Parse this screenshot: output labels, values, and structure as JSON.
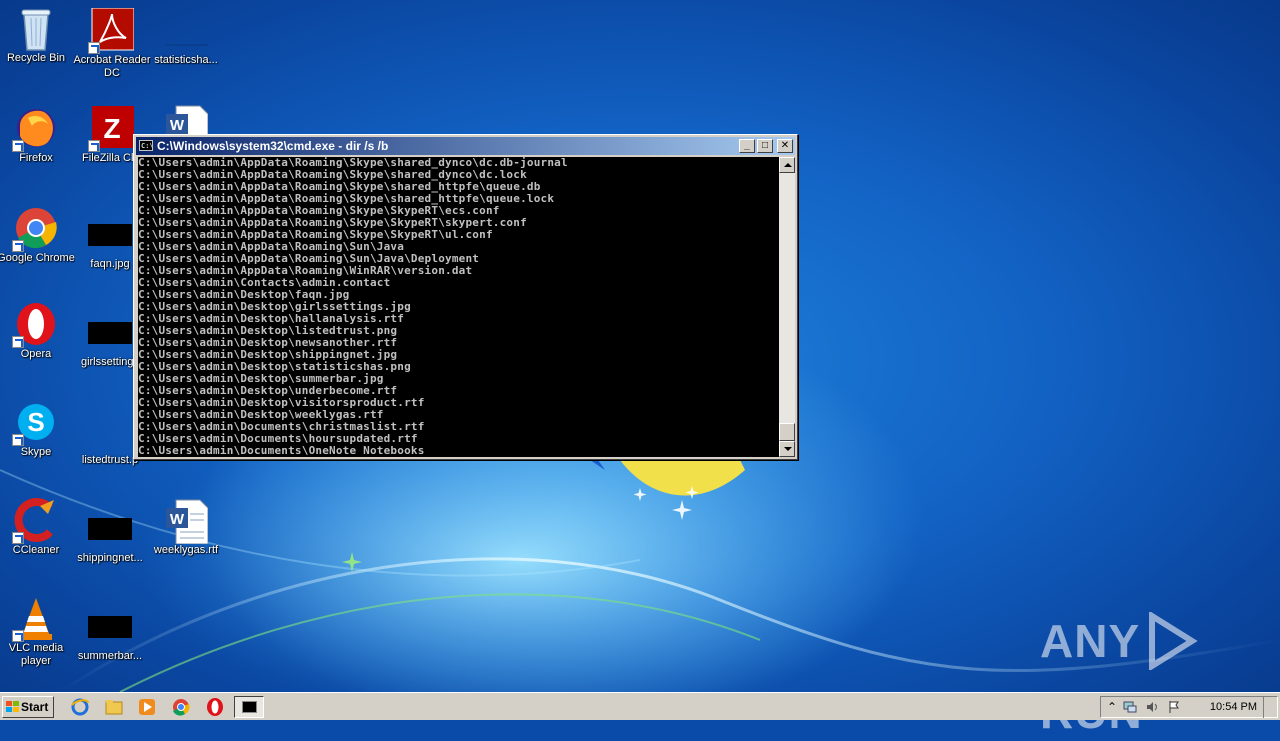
{
  "desktop": {
    "icons": [
      {
        "label": "Recycle Bin",
        "icon": "recycle-bin-icon"
      },
      {
        "label": "Acrobat Reader DC",
        "icon": "acrobat-icon"
      },
      {
        "label": "statisticsha...",
        "icon": "image-file-icon"
      },
      {
        "label": "Firefox",
        "icon": "firefox-icon"
      },
      {
        "label": "FileZilla Clie",
        "icon": "filezilla-icon"
      },
      {
        "label": "Google Chrome",
        "icon": "chrome-icon"
      },
      {
        "label": "faqn.jpg",
        "icon": "image-file-icon"
      },
      {
        "label": "Opera",
        "icon": "opera-icon"
      },
      {
        "label": "girlssettings",
        "icon": "image-file-icon"
      },
      {
        "label": "Skype",
        "icon": "skype-icon"
      },
      {
        "label": "listedtrust.p",
        "icon": "image-file-icon"
      },
      {
        "label": "CCleaner",
        "icon": "ccleaner-icon"
      },
      {
        "label": "shippingnet...",
        "icon": "image-file-icon"
      },
      {
        "label": "weeklygas.rtf",
        "icon": "word-document-icon"
      },
      {
        "label": "VLC media player",
        "icon": "vlc-icon"
      },
      {
        "label": "summerbar...",
        "icon": "image-file-icon"
      }
    ]
  },
  "cmd_window": {
    "title": "C:\\Windows\\system32\\cmd.exe - dir  /s /b",
    "minimize": "_",
    "maximize": "□",
    "close": "✕",
    "lines": [
      "C:\\Users\\admin\\AppData\\Roaming\\Skype\\shared_dynco\\dc.db-journal",
      "C:\\Users\\admin\\AppData\\Roaming\\Skype\\shared_dynco\\dc.lock",
      "C:\\Users\\admin\\AppData\\Roaming\\Skype\\shared_httpfe\\queue.db",
      "C:\\Users\\admin\\AppData\\Roaming\\Skype\\shared_httpfe\\queue.lock",
      "C:\\Users\\admin\\AppData\\Roaming\\Skype\\SkypeRT\\ecs.conf",
      "C:\\Users\\admin\\AppData\\Roaming\\Skype\\SkypeRT\\skypert.conf",
      "C:\\Users\\admin\\AppData\\Roaming\\Skype\\SkypeRT\\ul.conf",
      "C:\\Users\\admin\\AppData\\Roaming\\Sun\\Java",
      "C:\\Users\\admin\\AppData\\Roaming\\Sun\\Java\\Deployment",
      "C:\\Users\\admin\\AppData\\Roaming\\WinRAR\\version.dat",
      "C:\\Users\\admin\\Contacts\\admin.contact",
      "C:\\Users\\admin\\Desktop\\faqn.jpg",
      "C:\\Users\\admin\\Desktop\\girlssettings.jpg",
      "C:\\Users\\admin\\Desktop\\hallanalysis.rtf",
      "C:\\Users\\admin\\Desktop\\listedtrust.png",
      "C:\\Users\\admin\\Desktop\\newsanother.rtf",
      "C:\\Users\\admin\\Desktop\\shippingnet.jpg",
      "C:\\Users\\admin\\Desktop\\statisticshas.png",
      "C:\\Users\\admin\\Desktop\\summerbar.jpg",
      "C:\\Users\\admin\\Desktop\\underbecome.rtf",
      "C:\\Users\\admin\\Desktop\\visitorsproduct.rtf",
      "C:\\Users\\admin\\Desktop\\weeklygas.rtf",
      "C:\\Users\\admin\\Documents\\christmaslist.rtf",
      "C:\\Users\\admin\\Documents\\hoursupdated.rtf",
      "C:\\Users\\admin\\Documents\\OneNote Notebooks"
    ]
  },
  "watermark": {
    "left": "ANY",
    "right": "RUN"
  },
  "taskbar": {
    "start_label": "Start",
    "clock": "10:54 PM"
  },
  "colors": {
    "console_bg": "#000000",
    "console_text": "#c0c0c0",
    "titlebar_start": "#0a246a",
    "titlebar_end": "#a6caf0"
  }
}
